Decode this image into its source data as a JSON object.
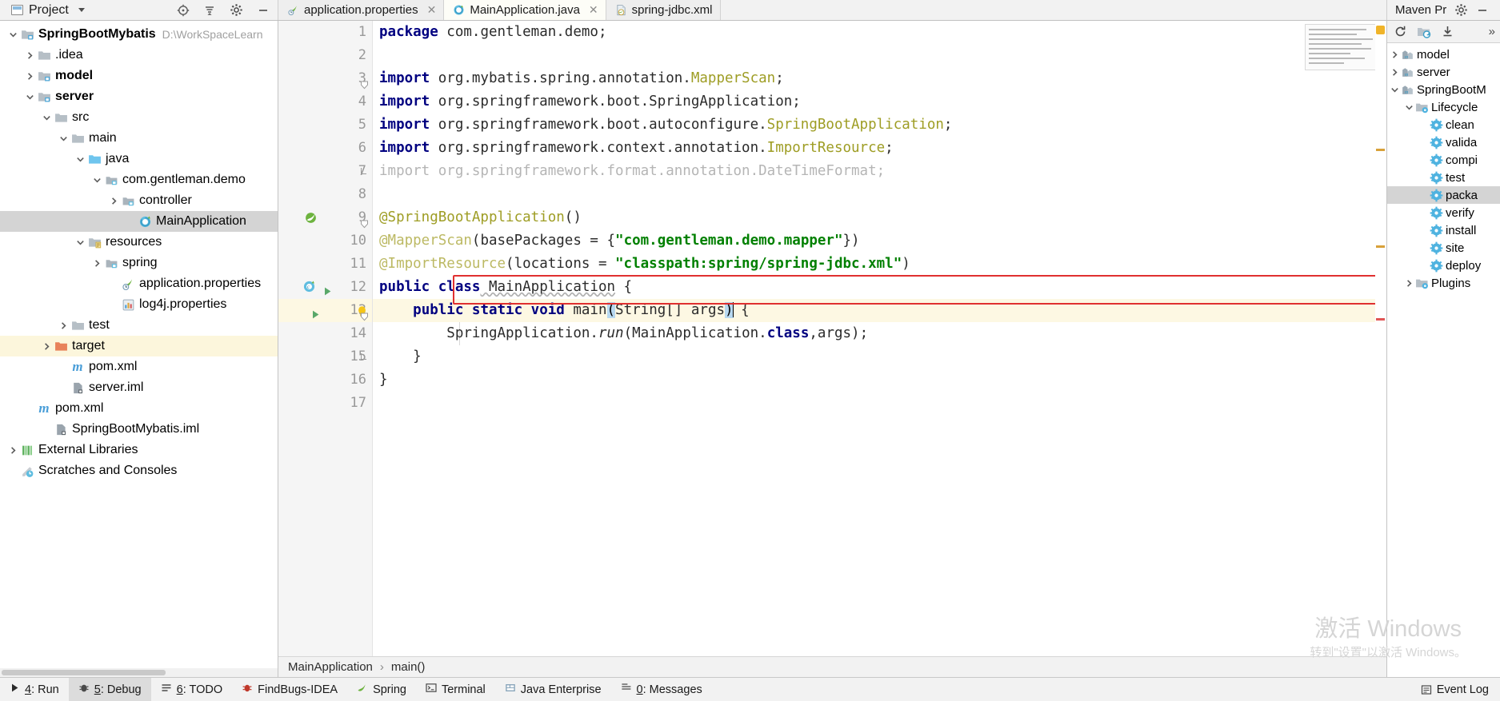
{
  "window": {
    "project_panel_title": "Project",
    "maven_panel_title": "Maven Pr",
    "watermark_line1": "激活 Windows",
    "watermark_line2": "转到\"设置\"以激活 Windows。"
  },
  "project_tree": [
    {
      "label": "SpringBootMybatis",
      "path": "D:\\WorkSpaceLearn",
      "indent": 0,
      "arrow": "down",
      "icon": "module-folder-icon",
      "bold": true,
      "state": "normal"
    },
    {
      "label": ".idea",
      "path": "",
      "indent": 1,
      "arrow": "right",
      "icon": "folder-icon",
      "bold": false,
      "state": "normal"
    },
    {
      "label": "model",
      "path": "",
      "indent": 1,
      "arrow": "right",
      "icon": "module-folder-icon",
      "bold": true,
      "state": "normal"
    },
    {
      "label": "server",
      "path": "",
      "indent": 1,
      "arrow": "down",
      "icon": "module-folder-icon",
      "bold": true,
      "state": "normal"
    },
    {
      "label": "src",
      "path": "",
      "indent": 2,
      "arrow": "down",
      "icon": "folder-icon",
      "bold": false,
      "state": "normal"
    },
    {
      "label": "main",
      "path": "",
      "indent": 3,
      "arrow": "down",
      "icon": "folder-icon",
      "bold": false,
      "state": "normal"
    },
    {
      "label": "java",
      "path": "",
      "indent": 4,
      "arrow": "down",
      "icon": "source-folder-icon",
      "bold": false,
      "state": "normal"
    },
    {
      "label": "com.gentleman.demo",
      "path": "",
      "indent": 5,
      "arrow": "down",
      "icon": "package-icon",
      "bold": false,
      "state": "normal"
    },
    {
      "label": "controller",
      "path": "",
      "indent": 6,
      "arrow": "right",
      "icon": "package-icon",
      "bold": false,
      "state": "normal"
    },
    {
      "label": "MainApplication",
      "path": "",
      "indent": 7,
      "arrow": "none",
      "icon": "spring-class-icon",
      "bold": false,
      "state": "selected"
    },
    {
      "label": "resources",
      "path": "",
      "indent": 4,
      "arrow": "down",
      "icon": "resources-folder-icon",
      "bold": false,
      "state": "normal"
    },
    {
      "label": "spring",
      "path": "",
      "indent": 5,
      "arrow": "right",
      "icon": "package-icon",
      "bold": false,
      "state": "normal"
    },
    {
      "label": "application.properties",
      "path": "",
      "indent": 6,
      "arrow": "none",
      "icon": "spring-properties-icon",
      "bold": false,
      "state": "normal"
    },
    {
      "label": "log4j.properties",
      "path": "",
      "indent": 6,
      "arrow": "none",
      "icon": "properties-icon",
      "bold": false,
      "state": "normal"
    },
    {
      "label": "test",
      "path": "",
      "indent": 3,
      "arrow": "right",
      "icon": "folder-icon",
      "bold": false,
      "state": "normal"
    },
    {
      "label": "target",
      "path": "",
      "indent": 2,
      "arrow": "right",
      "icon": "excluded-folder-icon",
      "bold": false,
      "state": "highlighted"
    },
    {
      "label": "pom.xml",
      "path": "",
      "indent": 3,
      "arrow": "none",
      "icon": "maven-pom-icon",
      "bold": false,
      "state": "normal"
    },
    {
      "label": "server.iml",
      "path": "",
      "indent": 3,
      "arrow": "none",
      "icon": "iml-icon",
      "bold": false,
      "state": "normal"
    },
    {
      "label": "pom.xml",
      "path": "",
      "indent": 1,
      "arrow": "none",
      "icon": "maven-pom-icon",
      "bold": false,
      "state": "normal"
    },
    {
      "label": "SpringBootMybatis.iml",
      "path": "",
      "indent": 2,
      "arrow": "none",
      "icon": "iml-icon",
      "bold": false,
      "state": "normal"
    },
    {
      "label": "External Libraries",
      "path": "",
      "indent": 0,
      "arrow": "right",
      "icon": "libraries-icon",
      "bold": false,
      "state": "normal"
    },
    {
      "label": "Scratches and Consoles",
      "path": "",
      "indent": 0,
      "arrow": "none",
      "icon": "scratches-icon",
      "bold": false,
      "state": "normal"
    }
  ],
  "tabs": [
    {
      "label": "application.properties",
      "icon": "spring-properties-icon",
      "active": false
    },
    {
      "label": "MainApplication.java",
      "icon": "spring-class-icon",
      "active": true
    },
    {
      "label": "spring-jdbc.xml",
      "icon": "spring-xml-icon",
      "active": false
    }
  ],
  "editor": {
    "lines": [
      {
        "n": "1",
        "gutter_icon": "",
        "fold": "",
        "current": false
      },
      {
        "n": "2",
        "gutter_icon": "",
        "fold": "",
        "current": false
      },
      {
        "n": "3",
        "gutter_icon": "",
        "fold": "collapse",
        "current": false
      },
      {
        "n": "4",
        "gutter_icon": "",
        "fold": "",
        "current": false
      },
      {
        "n": "5",
        "gutter_icon": "",
        "fold": "",
        "current": false
      },
      {
        "n": "6",
        "gutter_icon": "",
        "fold": "",
        "current": false
      },
      {
        "n": "7",
        "gutter_icon": "",
        "fold": "end",
        "current": false
      },
      {
        "n": "8",
        "gutter_icon": "",
        "fold": "",
        "current": false
      },
      {
        "n": "9",
        "gutter_icon": "spring-bean-icon",
        "fold": "collapse",
        "current": false
      },
      {
        "n": "10",
        "gutter_icon": "",
        "fold": "",
        "current": false
      },
      {
        "n": "11",
        "gutter_icon": "",
        "fold": "",
        "current": false
      },
      {
        "n": "12",
        "gutter_icon": "spring-class-run-icon",
        "fold": "",
        "current": false
      },
      {
        "n": "13",
        "gutter_icon": "run-bulb-icon",
        "fold": "collapse",
        "current": true
      },
      {
        "n": "14",
        "gutter_icon": "",
        "fold": "",
        "current": false
      },
      {
        "n": "15",
        "gutter_icon": "",
        "fold": "end",
        "current": false
      },
      {
        "n": "16",
        "gutter_icon": "",
        "fold": "",
        "current": false
      },
      {
        "n": "17",
        "gutter_icon": "",
        "fold": "",
        "current": false
      }
    ],
    "code": {
      "l1_kw": "package",
      "l1_rest": " com.gentleman.demo;",
      "l3_kw": "import",
      "l3_pkg": " org.mybatis.spring.annotation.",
      "l3_cls": "MapperScan",
      "l3_end": ";",
      "l4_kw": "import",
      "l4_pkg": " org.springframework.boot.",
      "l4_cls": "SpringApplication",
      "l4_end": ";",
      "l5_kw": "import",
      "l5_pkg": " org.springframework.boot.autoconfigure.",
      "l5_cls": "SpringBootApplication",
      "l5_end": ";",
      "l6_kw": "import",
      "l6_pkg": " org.springframework.context.annotation.",
      "l6_cls": "ImportResource",
      "l6_end": ";",
      "l7_all": "import org.springframework.format.annotation.DateTimeFormat;",
      "l9_anno": "@SpringBootApplication",
      "l9_rest": "()",
      "l10_anno": "@MapperScan",
      "l10_mid": "(basePackages = {",
      "l10_str": "\"com.gentleman.demo.mapper\"",
      "l10_end": "})",
      "l11_anno": "@ImportResource",
      "l11_mid": "(locations = ",
      "l11_str": "\"classpath:spring/spring-jdbc.xml\"",
      "l11_end": ")",
      "l12_kw": "public class",
      "l12_name": " MainApplication",
      "l12_end": " {",
      "l13_kw": "public static void",
      "l13_name": " main",
      "l13_p1": "(",
      "l13_args": "String[] args",
      "l13_p2": ")",
      "l13_end": " {",
      "l14_a": "SpringApplication.",
      "l14_run": "run",
      "l14_b": "(MainApplication.",
      "l14_class": "class",
      "l14_c": ",args);",
      "l15": "}",
      "l16": "}"
    }
  },
  "breadcrumb": {
    "item1": "MainApplication",
    "separator": "›",
    "item2": "main()"
  },
  "maven_tree": [
    {
      "label": "model",
      "indent": 0,
      "arrow": "right",
      "icon": "maven-module-icon",
      "state": "normal"
    },
    {
      "label": "server",
      "indent": 0,
      "arrow": "right",
      "icon": "maven-module-icon",
      "state": "normal"
    },
    {
      "label": "SpringBootM",
      "indent": 0,
      "arrow": "down",
      "icon": "maven-module-icon",
      "state": "normal"
    },
    {
      "label": "Lifecycle",
      "indent": 1,
      "arrow": "down",
      "icon": "lifecycle-folder-icon",
      "state": "normal"
    },
    {
      "label": "clean",
      "indent": 2,
      "arrow": "none",
      "icon": "gear-icon",
      "state": "normal"
    },
    {
      "label": "valida",
      "indent": 2,
      "arrow": "none",
      "icon": "gear-icon",
      "state": "normal"
    },
    {
      "label": "compi",
      "indent": 2,
      "arrow": "none",
      "icon": "gear-icon",
      "state": "normal"
    },
    {
      "label": "test",
      "indent": 2,
      "arrow": "none",
      "icon": "gear-icon",
      "state": "normal"
    },
    {
      "label": "packa",
      "indent": 2,
      "arrow": "none",
      "icon": "gear-icon",
      "state": "selected"
    },
    {
      "label": "verify",
      "indent": 2,
      "arrow": "none",
      "icon": "gear-icon",
      "state": "normal"
    },
    {
      "label": "install",
      "indent": 2,
      "arrow": "none",
      "icon": "gear-icon",
      "state": "normal"
    },
    {
      "label": "site",
      "indent": 2,
      "arrow": "none",
      "icon": "gear-icon",
      "state": "normal"
    },
    {
      "label": "deploy",
      "indent": 2,
      "arrow": "none",
      "icon": "gear-icon",
      "state": "normal"
    },
    {
      "label": "Plugins",
      "indent": 1,
      "arrow": "right",
      "icon": "plugins-folder-icon",
      "state": "normal"
    }
  ],
  "statusbar": {
    "items": [
      {
        "num": "4",
        "label": ": Run",
        "icon": "run-icon",
        "active": false
      },
      {
        "num": "5",
        "label": ": Debug",
        "icon": "debug-icon",
        "active": true
      },
      {
        "num": "6",
        "label": ": TODO",
        "icon": "todo-icon",
        "active": false
      },
      {
        "num": "",
        "label": "FindBugs-IDEA",
        "icon": "findbugs-icon",
        "active": false
      },
      {
        "num": "",
        "label": "Spring",
        "icon": "spring-icon",
        "active": false
      },
      {
        "num": "",
        "label": "Terminal",
        "icon": "terminal-icon",
        "active": false
      },
      {
        "num": "",
        "label": "Java Enterprise",
        "icon": "java-enterprise-icon",
        "active": false
      },
      {
        "num": "0",
        "label": ": Messages",
        "icon": "messages-icon",
        "active": false
      }
    ],
    "event_log": "Event Log",
    "event_log_icon": "event-log-icon"
  },
  "colors": {
    "keyword": "#000080",
    "string": "#008000",
    "annotation": "#9e9d24",
    "selection": "#d4d4d4",
    "highlight_row": "#fdf8e3",
    "redbox": "#e03030"
  }
}
